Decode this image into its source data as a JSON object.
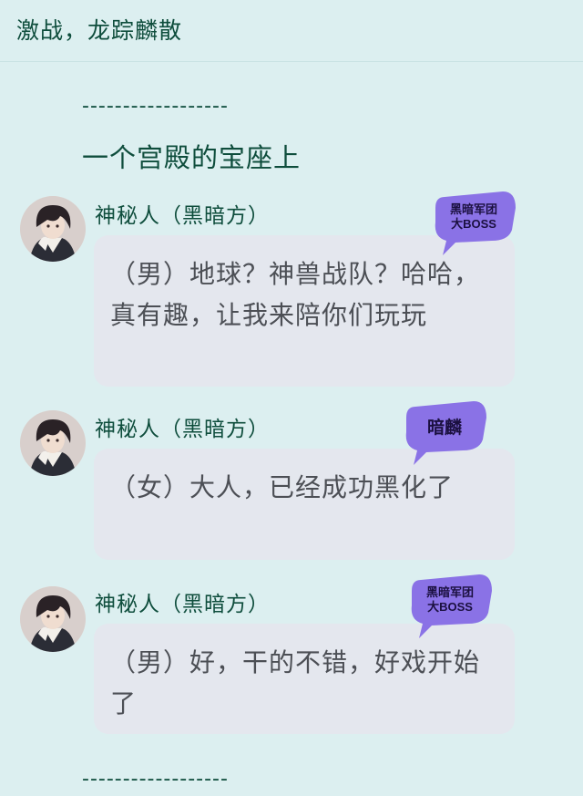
{
  "header": {
    "title": "激战，龙踪麟散"
  },
  "divider": {
    "text": "------------------"
  },
  "scene": {
    "text": "一个宫殿的宝座上"
  },
  "messages": [
    {
      "name": "神秘人（黑暗方）",
      "text": "（男）地球？神兽战队？哈哈，真有趣，让我来陪你们玩玩",
      "badge_line1": "黑暗军团",
      "badge_line2": "大BOSS"
    },
    {
      "name": "神秘人（黑暗方）",
      "text": "（女）大人，已经成功黑化了",
      "badge_line1": "暗麟",
      "badge_line2": ""
    },
    {
      "name": "神秘人（黑暗方）",
      "text": "（男）好，干的不错，好戏开始了",
      "badge_line1": "黑暗军团",
      "badge_line2": "大BOSS"
    }
  ],
  "colors": {
    "background": "#dceff0",
    "accent_text": "#0e4d3c",
    "bubble": "#e4e7ee",
    "badge": "#8a72e6"
  }
}
